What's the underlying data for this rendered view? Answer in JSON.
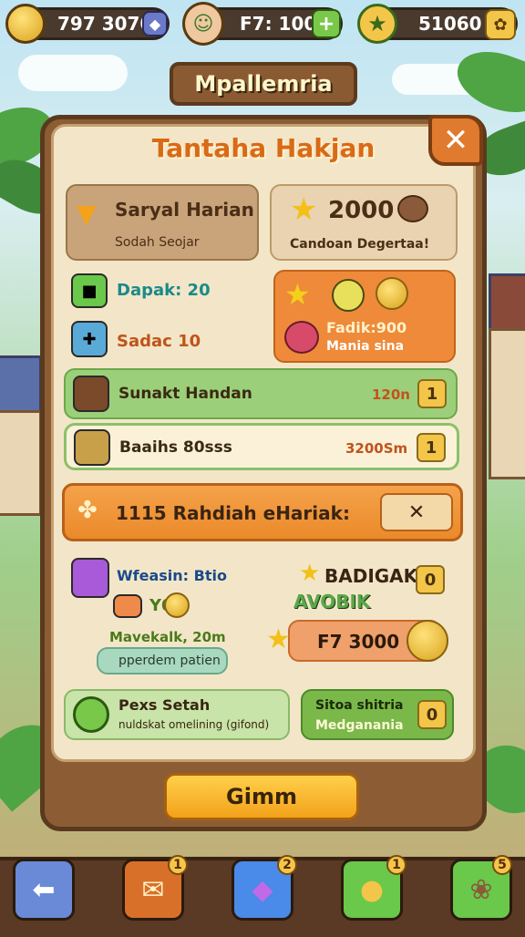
{
  "topbar": {
    "coins_value": "797 3070",
    "energy_value": "F7: 1000",
    "gems_value": "51060",
    "plus_label": "+"
  },
  "banner_title": "Mpallemria",
  "panel": {
    "title": "Tantaha Hakjan",
    "close_label": "✕",
    "daily_card": {
      "title": "Saryal Harian",
      "subtitle": "Sodah Seojar"
    },
    "star_card": {
      "value": "2000",
      "subtitle": "Candoan Degertaa!"
    },
    "item_rows": [
      {
        "label": "Dapak: 20"
      },
      {
        "label": "Sadac 10"
      }
    ],
    "orange_reward": {
      "line1": "Fadik:900",
      "line2": "Mania sina"
    },
    "green_rows": [
      {
        "label": "Sunakt Handan",
        "value": "120n",
        "badge": "1"
      },
      {
        "label": "Baaihs 80sss",
        "value": "3200Sm",
        "badge": "1"
      }
    ],
    "big_bar": {
      "label": "1115 Rahdiah eHariak:",
      "button_label": "✕"
    },
    "lower_left": {
      "title": "Wfeasin: Btio",
      "sub": "Y0",
      "line": "Mavekalk, 20m",
      "pill": "pperdem patien"
    },
    "lower_right": {
      "line1": "BADIGAK",
      "line2": "AVOBIK",
      "badge": "0",
      "value": "F7 3000"
    },
    "bottom_left": {
      "title": "Pexs Setah",
      "sub": "nuldskat omelining (gifond)"
    },
    "bottom_right": {
      "line1": "Sitoa shitria",
      "line2": "Medganania",
      "badge": "0"
    }
  },
  "claim_label": "Gimm",
  "nav": [
    {
      "icon": "back-arrow-icon",
      "glyph": "⬅",
      "count": ""
    },
    {
      "icon": "chest-icon",
      "glyph": "✉",
      "count": "1"
    },
    {
      "icon": "gem-icon",
      "glyph": "◆",
      "count": "2"
    },
    {
      "icon": "coin-icon",
      "glyph": "●",
      "count": "1"
    },
    {
      "icon": "cookie-icon",
      "glyph": "❀",
      "count": "5"
    }
  ],
  "colors": {
    "accent": "#e07a2e",
    "gold": "#f3c64a",
    "wood": "#8c5d35",
    "paper": "#f3e6c8",
    "green": "#8ec86a"
  }
}
